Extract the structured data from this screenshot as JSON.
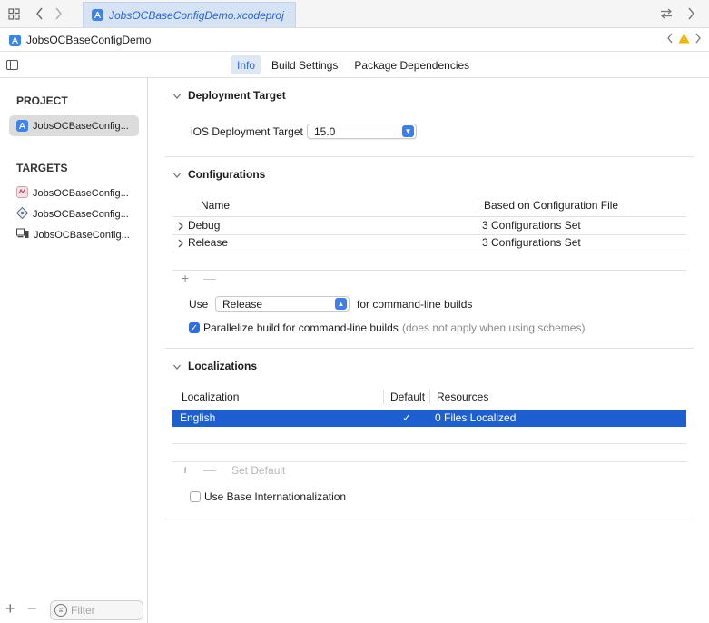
{
  "tabbar": {
    "active_tab": "JobsOCBaseConfigDemo.xcodeproj",
    "icons": [
      "grid-icon",
      "back-icon",
      "forward-icon",
      "swap-icon",
      "chevron-right-icon"
    ]
  },
  "jumpbar": {
    "title": "JobsOCBaseConfigDemo"
  },
  "editor_tabs": [
    "Info",
    "Build Settings",
    "Package Dependencies"
  ],
  "editor_selected": "Info",
  "sidebar": {
    "project_header": "PROJECT",
    "project_item": "JobsOCBaseConfig...",
    "targets_header": "TARGETS",
    "targets": [
      "JobsOCBaseConfig...",
      "JobsOCBaseConfig...",
      "JobsOCBaseConfig..."
    ],
    "filter_placeholder": "Filter"
  },
  "deployment": {
    "title": "Deployment Target",
    "ios_label": "iOS Deployment Target",
    "ios_value": "15.0"
  },
  "configurations": {
    "title": "Configurations",
    "col_name": "Name",
    "col_based": "Based on Configuration File",
    "rows": [
      {
        "name": "Debug",
        "based": "3 Configurations Set"
      },
      {
        "name": "Release",
        "based": "3 Configurations Set"
      }
    ],
    "use_label": "Use",
    "use_value": "Release",
    "use_suffix": "for command-line builds",
    "parallelize_label": "Parallelize build for command-line builds",
    "parallelize_note": "(does not apply when using schemes)",
    "parallelize_checked": true
  },
  "localizations": {
    "title": "Localizations",
    "col_localization": "Localization",
    "col_default": "Default",
    "col_resources": "Resources",
    "rows": [
      {
        "localization": "English",
        "default": "✓",
        "resources": "0 Files Localized"
      }
    ],
    "set_default": "Set Default",
    "base_intl_label": "Use Base Internationalization",
    "base_intl_checked": false
  },
  "colors": {
    "accent": "#2d6fe0",
    "selection": "#1d5fd0",
    "warning": "#f2b400"
  }
}
